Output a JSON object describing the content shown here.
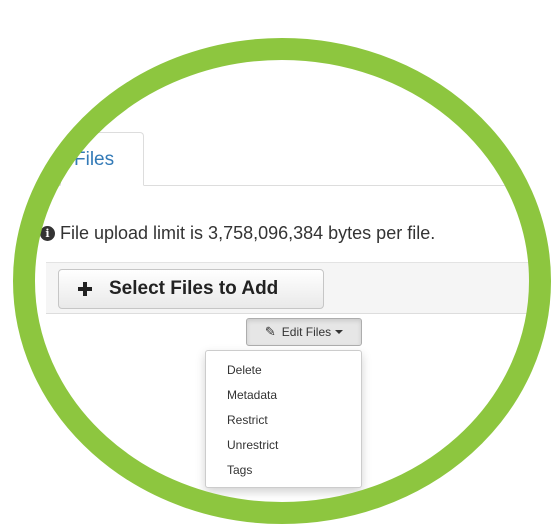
{
  "tabs": [
    {
      "label": "Files"
    }
  ],
  "upload": {
    "limit_message": "File upload limit is 3,758,096,384 bytes per file.",
    "select_button_label": "Select Files to Add"
  },
  "edit_files": {
    "button_label": "Edit Files",
    "menu_items": [
      {
        "label": "Delete"
      },
      {
        "label": "Metadata"
      },
      {
        "label": "Restrict"
      },
      {
        "label": "Unrestrict"
      },
      {
        "label": "Tags"
      }
    ]
  },
  "colors": {
    "ring": "#8dc63f",
    "tab_link": "#337ab7"
  },
  "icons": {
    "info": "info-circle-icon",
    "plus": "plus-icon",
    "pencil": "pencil-icon",
    "caret": "caret-down-icon"
  }
}
